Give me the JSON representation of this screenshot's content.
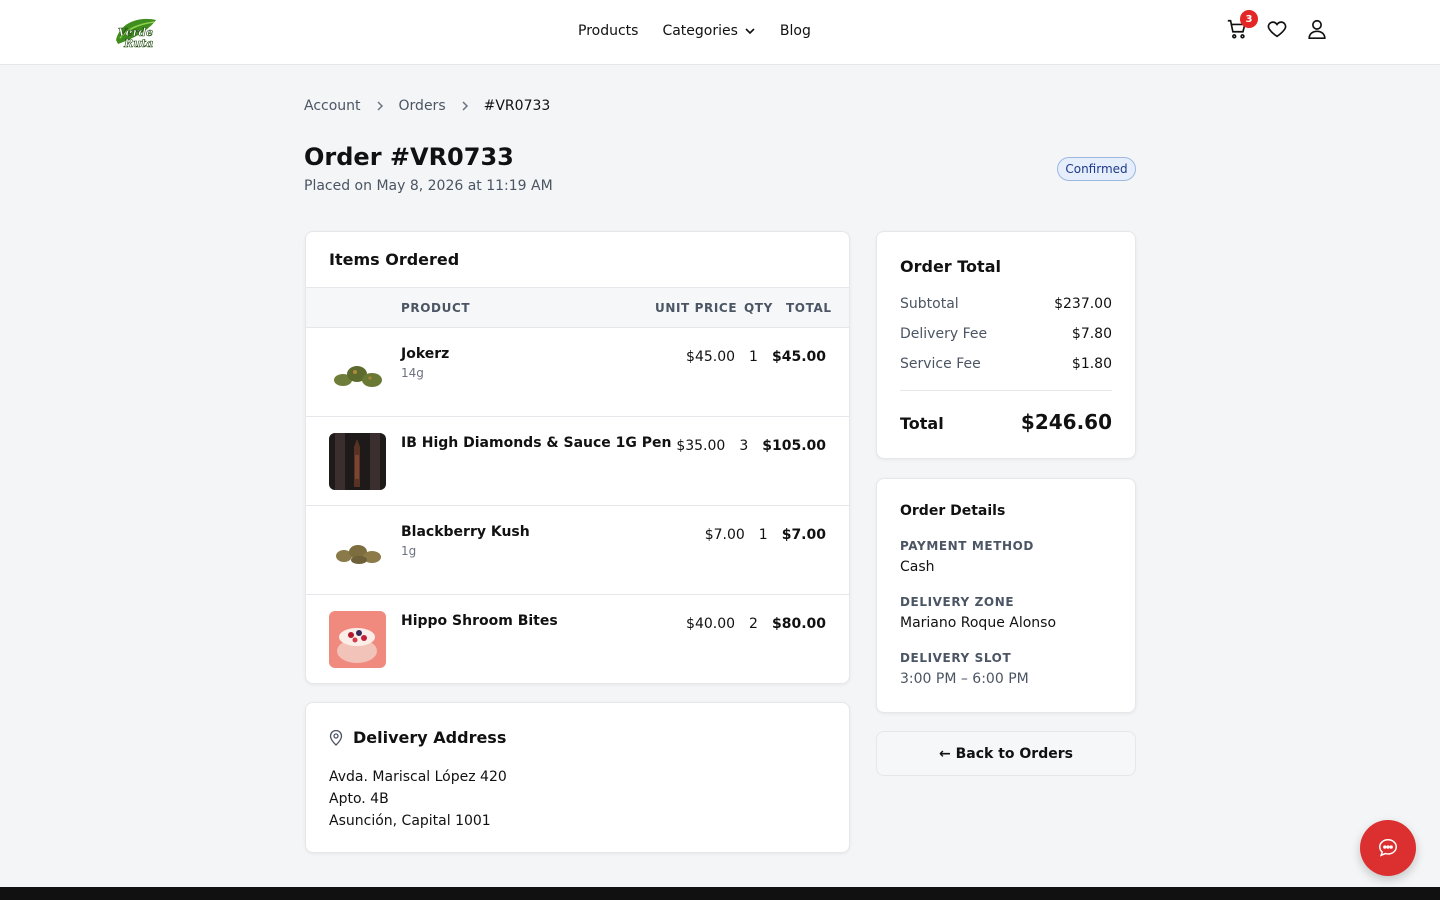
{
  "header": {
    "logo_text": "Verde Ruta",
    "nav": {
      "products": "Products",
      "categories": "Categories",
      "blog": "Blog"
    },
    "cart_count": "3"
  },
  "breadcrumb": {
    "account": "Account",
    "orders": "Orders",
    "current": "#VR0733"
  },
  "order": {
    "title": "Order #VR0733",
    "placed": "Placed on May 8, 2026 at 11:19 AM",
    "status": "Confirmed"
  },
  "items": {
    "title": "Items Ordered",
    "headers": {
      "product": "PRODUCT",
      "unit_price": "UNIT PRICE",
      "qty": "QTY",
      "total": "TOTAL"
    },
    "rows": [
      {
        "name": "Jokerz",
        "variant": "14g",
        "unit_price": "$45.00",
        "qty": "1",
        "total": "$45.00",
        "thumb": "green-buds"
      },
      {
        "name": "IB High Diamonds & Sauce 1G Pen",
        "variant": "",
        "unit_price": "$35.00",
        "qty": "3",
        "total": "$105.00",
        "thumb": "vape-pen"
      },
      {
        "name": "Blackberry Kush",
        "variant": "1g",
        "unit_price": "$7.00",
        "qty": "1",
        "total": "$7.00",
        "thumb": "brown-buds"
      },
      {
        "name": "Hippo Shroom Bites",
        "variant": "",
        "unit_price": "$40.00",
        "qty": "2",
        "total": "$80.00",
        "thumb": "berry-bowl"
      }
    ]
  },
  "delivery_address": {
    "title": "Delivery Address",
    "line1": "Avda. Mariscal López 420",
    "line2": "Apto. 4B",
    "line3": "Asunción, Capital 1001"
  },
  "totals": {
    "title": "Order Total",
    "subtotal_label": "Subtotal",
    "subtotal": "$237.00",
    "delivery_label": "Delivery Fee",
    "delivery": "$7.80",
    "service_label": "Service Fee",
    "service": "$1.80",
    "total_label": "Total",
    "total": "$246.60"
  },
  "details": {
    "title": "Order Details",
    "payment_label": "PAYMENT METHOD",
    "payment": "Cash",
    "zone_label": "DELIVERY ZONE",
    "zone": "Mariano Roque Alonso",
    "slot_label": "DELIVERY SLOT",
    "slot": "3:00 PM – 6:00 PM"
  },
  "back_button": "← Back to Orders",
  "colors": {
    "accent_red": "#dc2f2f",
    "status_blue": "#1e3a8a",
    "brand_green": "#3a8a1f"
  }
}
